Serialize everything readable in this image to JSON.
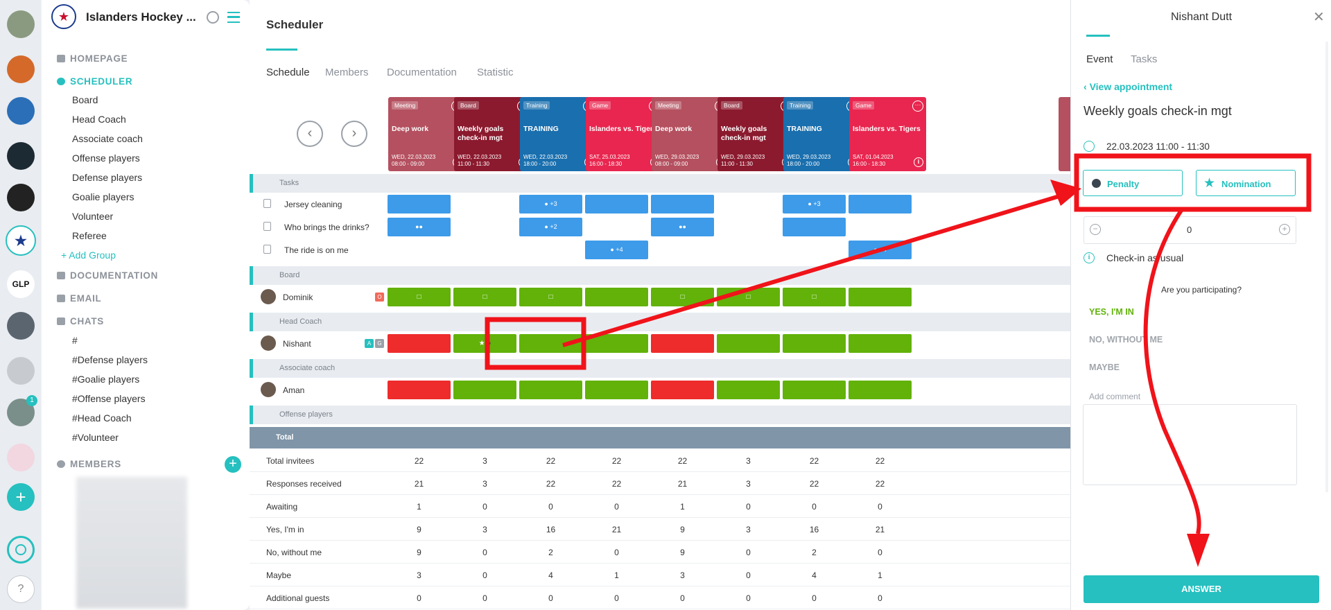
{
  "sidebar": {
    "org_name": "Islanders Hockey ...",
    "nav": {
      "homepage": "HOMEPAGE",
      "scheduler": "SCHEDULER",
      "documentation": "DOCUMENTATION",
      "email": "EMAIL",
      "chats": "CHATS",
      "members": "MEMBERS"
    },
    "groups": [
      "Board",
      "Head Coach",
      "Associate coach",
      "Offense players",
      "Defense players",
      "Goalie players",
      "Volunteer",
      "Referee"
    ],
    "add_group": "+ Add Group",
    "chats": [
      "#",
      "#Defense players",
      "#Goalie players",
      "#Offense players",
      "#Head Coach",
      "#Volunteer"
    ],
    "rail_badge": "1"
  },
  "main": {
    "title": "Scheduler",
    "tabs": [
      "Schedule",
      "Members",
      "Documentation",
      "Statistic"
    ],
    "events": [
      {
        "tag": "Meeting",
        "title": "Deep work",
        "date": "WED, 22.03.2023",
        "time": "08:00 - 09:00",
        "color": "#b4505f"
      },
      {
        "tag": "Board",
        "title": "Weekly goals check-in mgt",
        "date": "WED, 22.03.2023",
        "time": "11:00 - 11:30",
        "color": "#8b1a2e"
      },
      {
        "tag": "Training",
        "title": "TRAINING",
        "date": "WED, 22.03.2023",
        "time": "18:00 - 20:00",
        "color": "#1a6fae"
      },
      {
        "tag": "Game",
        "title": "Islanders vs. Tigers",
        "date": "SAT, 25.03.2023",
        "time": "16:00 - 18:30",
        "color": "#e8264f"
      },
      {
        "tag": "Meeting",
        "title": "Deep work",
        "date": "WED, 29.03.2023",
        "time": "08:00 - 09:00",
        "color": "#b4505f"
      },
      {
        "tag": "Board",
        "title": "Weekly goals check-in mgt",
        "date": "WED, 29.03.2023",
        "time": "11:00 - 11:30",
        "color": "#8b1a2e"
      },
      {
        "tag": "Training",
        "title": "TRAINING",
        "date": "WED, 29.03.2023",
        "time": "18:00 - 20:00",
        "color": "#1a6fae"
      },
      {
        "tag": "Game",
        "title": "Islanders vs. Tigers",
        "date": "SAT, 01.04.2023",
        "time": "16:00 - 18:30",
        "color": "#e8264f"
      }
    ],
    "sections": {
      "tasks": "Tasks",
      "board": "Board",
      "head_coach": "Head Coach",
      "assoc": "Associate coach",
      "offense": "Offense players",
      "total": "Total"
    },
    "tasks": [
      {
        "label": "Jersey cleaning",
        "cells": [
          [
            "b",
            ""
          ],
          [
            "",
            ""
          ],
          [
            "b",
            "+3"
          ],
          [
            "b",
            ""
          ],
          [
            "b",
            ""
          ],
          [
            "",
            ""
          ],
          [
            "b",
            "+3"
          ],
          [
            "b",
            ""
          ]
        ]
      },
      {
        "label": "Who brings the drinks?",
        "cells": [
          [
            "b",
            "users"
          ],
          [
            "",
            ""
          ],
          [
            "b",
            "+2"
          ],
          [
            "",
            ""
          ],
          [
            "b",
            "users"
          ],
          [
            "",
            ""
          ],
          [
            "b",
            ""
          ],
          [
            "",
            ""
          ]
        ]
      },
      {
        "label": "The ride is on me",
        "cells": [
          [
            "",
            ""
          ],
          [
            "",
            ""
          ],
          [
            "",
            ""
          ],
          [
            "b",
            "+4"
          ],
          [
            "",
            ""
          ],
          [
            "",
            ""
          ],
          [
            "",
            ""
          ],
          [
            "b",
            "+4"
          ]
        ]
      }
    ],
    "members": [
      {
        "name": "Dominik",
        "badges": [
          "O"
        ],
        "cells": [
          "g",
          "g",
          "g",
          "g",
          "g",
          "g",
          "g",
          "g"
        ]
      },
      {
        "name": "Nishant",
        "badges": [
          "A",
          "G"
        ],
        "cells": [
          "r",
          "g",
          "g",
          "g",
          "r",
          "g",
          "g",
          "g"
        ]
      },
      {
        "name": "Aman",
        "badges": [],
        "cells": [
          "r",
          "g",
          "g",
          "g",
          "r",
          "g",
          "g",
          "g"
        ]
      }
    ],
    "totals": [
      {
        "label": "Total invitees",
        "values": [
          "22",
          "3",
          "22",
          "22",
          "22",
          "3",
          "22",
          "22"
        ]
      },
      {
        "label": "Responses received",
        "values": [
          "21",
          "3",
          "22",
          "22",
          "21",
          "3",
          "22",
          "22"
        ]
      },
      {
        "label": "Awaiting",
        "values": [
          "1",
          "0",
          "0",
          "0",
          "1",
          "0",
          "0",
          "0"
        ]
      },
      {
        "label": "Yes, I'm in",
        "values": [
          "9",
          "3",
          "16",
          "21",
          "9",
          "3",
          "16",
          "21"
        ]
      },
      {
        "label": "No, without me",
        "values": [
          "9",
          "0",
          "2",
          "0",
          "9",
          "0",
          "2",
          "0"
        ]
      },
      {
        "label": "Maybe",
        "values": [
          "3",
          "0",
          "4",
          "1",
          "3",
          "0",
          "4",
          "1"
        ]
      },
      {
        "label": "Additional guests",
        "values": [
          "0",
          "0",
          "0",
          "0",
          "0",
          "0",
          "0",
          "0"
        ]
      }
    ]
  },
  "panel": {
    "user": "Nishant Dutt",
    "tabs": [
      "Event",
      "Tasks"
    ],
    "view_link": "View appointment",
    "event_title": "Weekly goals check-in mgt",
    "datetime": "22.03.2023 11:00 - 11:30",
    "penalty": "Penalty",
    "nomination": "Nomination",
    "guests_value": "0",
    "note": "Check-in as usual",
    "question": "Are you participating?",
    "responses": [
      "YES, I'M IN",
      "NO, WITHOUT ME",
      "MAYBE"
    ],
    "comment_label": "Add comment",
    "answer": "ANSWER"
  },
  "colors": {
    "teal": "#25c0bf",
    "green": "#62b20a",
    "red": "#ee2c2c",
    "blue": "#3d9be9",
    "annot": "#f0131a"
  }
}
